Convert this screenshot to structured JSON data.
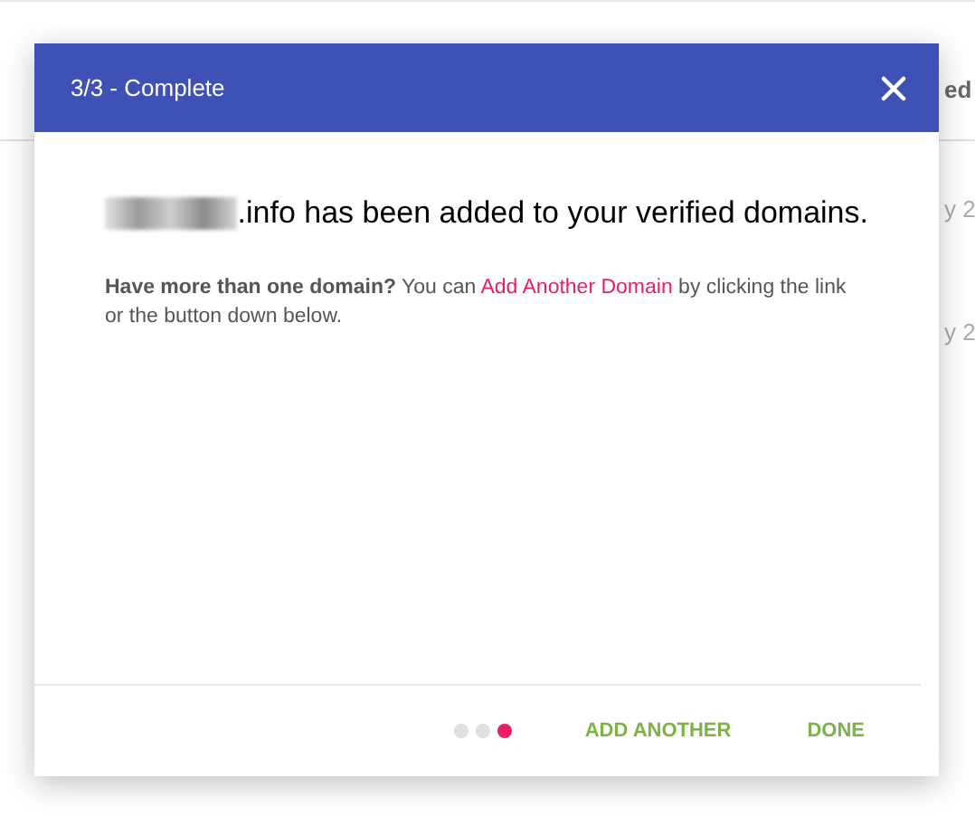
{
  "background": {
    "header_fragment": "ed",
    "row_fragments": [
      "y 2",
      "y 2"
    ]
  },
  "dialog": {
    "title": "3/3 - Complete",
    "message": ".info has been added to your verified domains.",
    "hint": "**Have more than one domain?** You can ",
    "hint_link": "Add Another Domain",
    "hint_end": " by clicking the link or the button down below.",
    "steps": [
      {
        "selected": false
      },
      {
        "selected": false
      },
      {
        "selected": true
      }
    ],
    "buttons": [
      "ADD ANOTHER",
      "DONE"
    ]
  }
}
